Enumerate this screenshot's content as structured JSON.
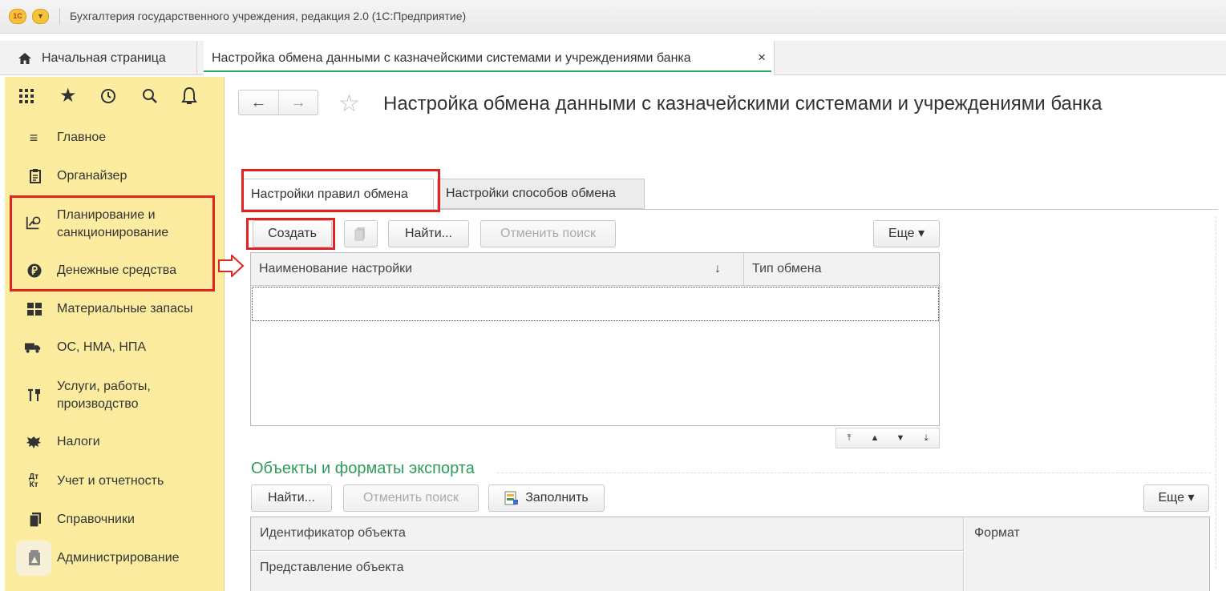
{
  "titlebar": {
    "logo": "1С",
    "menu_icon": "chevron-down-icon",
    "title": "Бухгалтерия государственного учреждения, редакция 2.0  (1С:Предприятие)"
  },
  "tabs": {
    "home_label": "Начальная страница",
    "doc_label": "Настройка обмена данными с казначейскими системами и учреждениями банка",
    "close": "×"
  },
  "sidebar": {
    "items": [
      {
        "label": "Главное",
        "icon": "list-icon"
      },
      {
        "label": "Органайзер",
        "icon": "clipboard-icon"
      },
      {
        "label": "Планирование и\nсанкционирование",
        "line1": "Планирование и",
        "line2": "санкционирование",
        "icon": "planning-icon"
      },
      {
        "label": "Денежные средства",
        "icon": "ruble-icon"
      },
      {
        "label": "Материальные запасы",
        "icon": "grid-icon"
      },
      {
        "label": "ОС, НМА, НПА",
        "icon": "truck-icon"
      },
      {
        "label": "Услуги, работы,\nпроизводство",
        "line1": "Услуги, работы,",
        "line2": "производство",
        "icon": "tools-icon"
      },
      {
        "label": "Налоги",
        "icon": "emblem-icon"
      },
      {
        "label": "Учет и отчетность",
        "icon": "accounting-icon"
      },
      {
        "label": "Справочники",
        "icon": "books-icon"
      },
      {
        "label": "Администрирование",
        "icon": "admin-icon"
      }
    ]
  },
  "main": {
    "title": "Настройка обмена данными с казначейскими системами и учреждениями банка",
    "tabs": [
      "Настройки правил обмена",
      "Настройки способов обмена"
    ],
    "toolbar1": {
      "create": "Создать",
      "find": "Найти...",
      "cancel_search": "Отменить поиск",
      "more": "Еще ▾"
    },
    "grid1": {
      "columns": [
        "Наименование настройки",
        "Тип обмена"
      ],
      "sort_indicator": "↓"
    },
    "section_title": "Объекты и форматы экспорта",
    "toolbar2": {
      "find": "Найти...",
      "cancel_search": "Отменить поиск",
      "fill": "Заполнить",
      "more": "Еще ▾"
    },
    "grid2": {
      "columns": [
        "Идентификатор объекта",
        "Формат"
      ],
      "subcolumn": "Представление объекта"
    }
  },
  "colors": {
    "sidebar_bg": "#fbeca0",
    "accent_green": "#2aa86b",
    "highlight_red": "#e02424",
    "section_green": "#2e9b5b"
  }
}
